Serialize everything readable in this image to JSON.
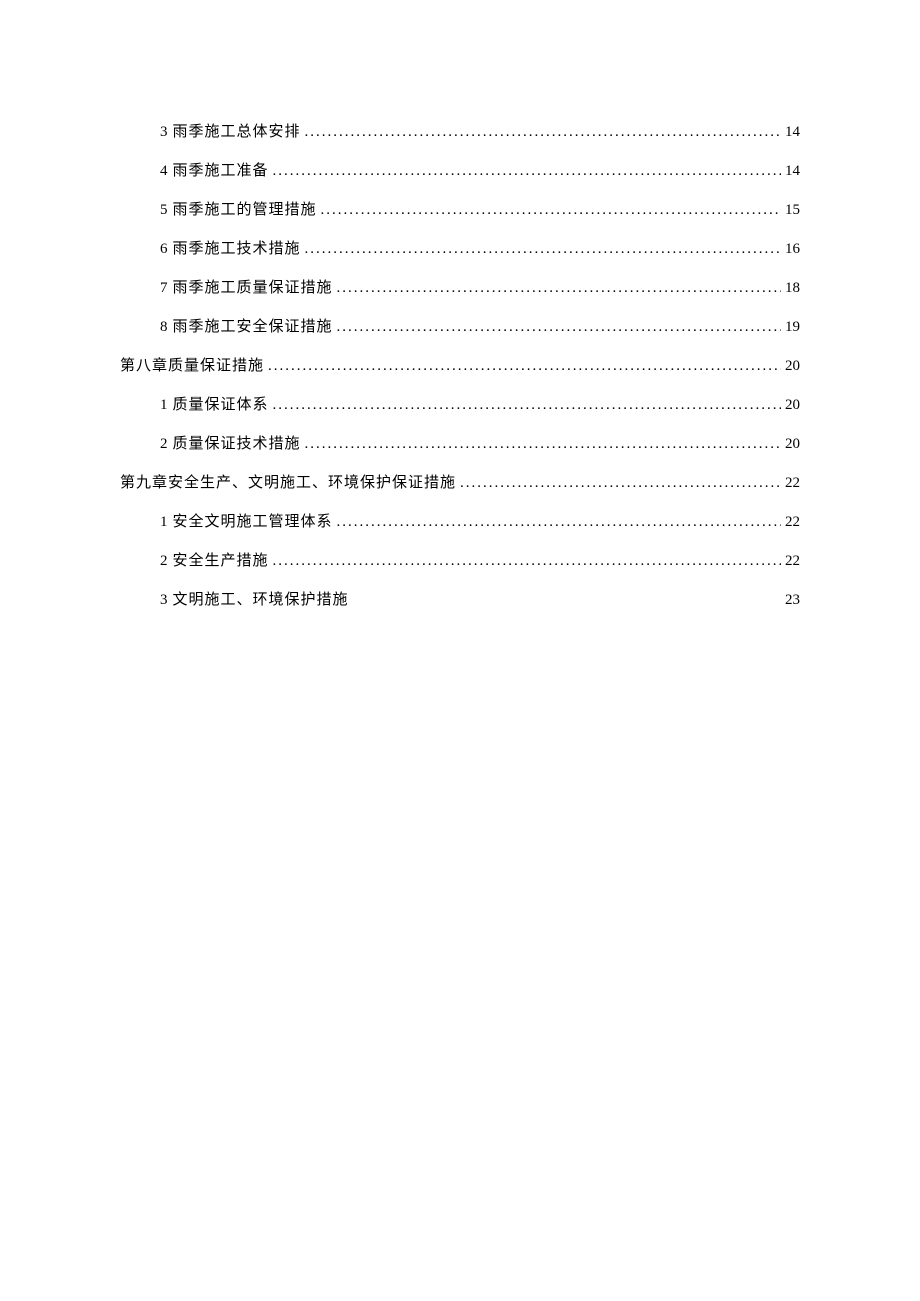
{
  "toc": [
    {
      "level": 2,
      "num": "3",
      "label": "雨季施工总体安排",
      "page": "14",
      "dots": true
    },
    {
      "level": 2,
      "num": "4",
      "label": "雨季施工准备",
      "page": "14",
      "dots": true
    },
    {
      "level": 2,
      "num": "5",
      "label": "雨季施工的管理措施",
      "page": "15",
      "dots": true
    },
    {
      "level": 2,
      "num": "6",
      "label": "雨季施工技术措施",
      "page": "16",
      "dots": true
    },
    {
      "level": 2,
      "num": "7",
      "label": "雨季施工质量保证措施",
      "page": "18",
      "dots": true
    },
    {
      "level": 2,
      "num": "8",
      "label": "雨季施工安全保证措施",
      "page": "19",
      "dots": true
    },
    {
      "level": 1,
      "num": "",
      "label": "第八章质量保证措施",
      "page": "20",
      "dots": true
    },
    {
      "level": 2,
      "num": "1",
      "label": "质量保证体系",
      "page": "20",
      "dots": true
    },
    {
      "level": 2,
      "num": "2",
      "label": "质量保证技术措施",
      "page": "20",
      "dots": true
    },
    {
      "level": 1,
      "num": "",
      "label": "第九章安全生产、文明施工、环境保护保证措施",
      "page": "22",
      "dots": true
    },
    {
      "level": 2,
      "num": "1",
      "label": "安全文明施工管理体系",
      "page": "22",
      "dots": true
    },
    {
      "level": 2,
      "num": "2",
      "label": "安全生产措施",
      "page": "22",
      "dots": true
    },
    {
      "level": 2,
      "num": "3",
      "label": "文明施工、环境保护措施",
      "page": "23",
      "dots": false
    }
  ]
}
